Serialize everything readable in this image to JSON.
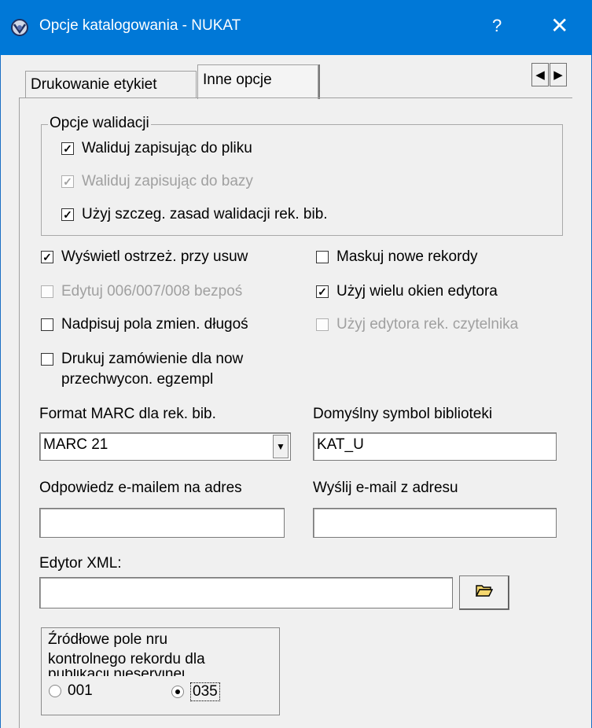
{
  "window": {
    "title": "Opcje katalogowania - NUKAT",
    "help": "?",
    "close": "✕"
  },
  "tabs": [
    {
      "label": "Drukowanie etykiet",
      "active": false
    },
    {
      "label": "Inne opcje",
      "active": true
    }
  ],
  "tab_scroll": {
    "left": "◀",
    "right": "▶"
  },
  "validation": {
    "title": "Opcje walidacji",
    "items": [
      {
        "label": "Waliduj zapisując do pliku",
        "checked": true,
        "enabled": true
      },
      {
        "label": "Waliduj zapisując do bazy",
        "checked": true,
        "enabled": false
      },
      {
        "label": "Użyj szczeg. zasad walidacji rek. bib.",
        "checked": true,
        "enabled": true
      }
    ]
  },
  "options": {
    "left": [
      {
        "label": "Wyświetl ostrzeż. przy usuw",
        "checked": true,
        "enabled": true
      },
      {
        "label": "Edytuj 006/007/008 bezpoś",
        "checked": false,
        "enabled": false
      },
      {
        "label": "Nadpisuj pola zmien. długoś",
        "checked": false,
        "enabled": true
      },
      {
        "label": "Drukuj zamówienie dla now",
        "label2": "przechwycon. egzempl",
        "checked": false,
        "enabled": true
      }
    ],
    "right": [
      {
        "label": "Maskuj nowe rekordy",
        "checked": false,
        "enabled": true
      },
      {
        "label": "Użyj wielu okien edytora",
        "checked": true,
        "enabled": true
      },
      {
        "label": "Użyj edytora rek. czytelnika",
        "checked": false,
        "enabled": false
      }
    ]
  },
  "check_mark": "✓",
  "marc_format": {
    "label": "Format MARC dla rek. bib.",
    "value": "MARC 21",
    "arrow": "▼"
  },
  "library_symbol": {
    "label": "Domyślny symbol biblioteki",
    "value": "KAT_U"
  },
  "reply_email": {
    "label": "Odpowiedz e-mailem na adres",
    "value": ""
  },
  "send_email": {
    "label": "Wyślij e-mail z adresu",
    "value": ""
  },
  "xml_editor": {
    "label": "Edytor XML:",
    "value": ""
  },
  "control_field": {
    "title_lines": [
      "Źródłowe pole nru",
      "kontrolnego rekordu dla",
      "publikacji nieseryjnej"
    ],
    "options": [
      {
        "label": "001",
        "selected": false
      },
      {
        "label": "035",
        "selected": true
      }
    ]
  }
}
